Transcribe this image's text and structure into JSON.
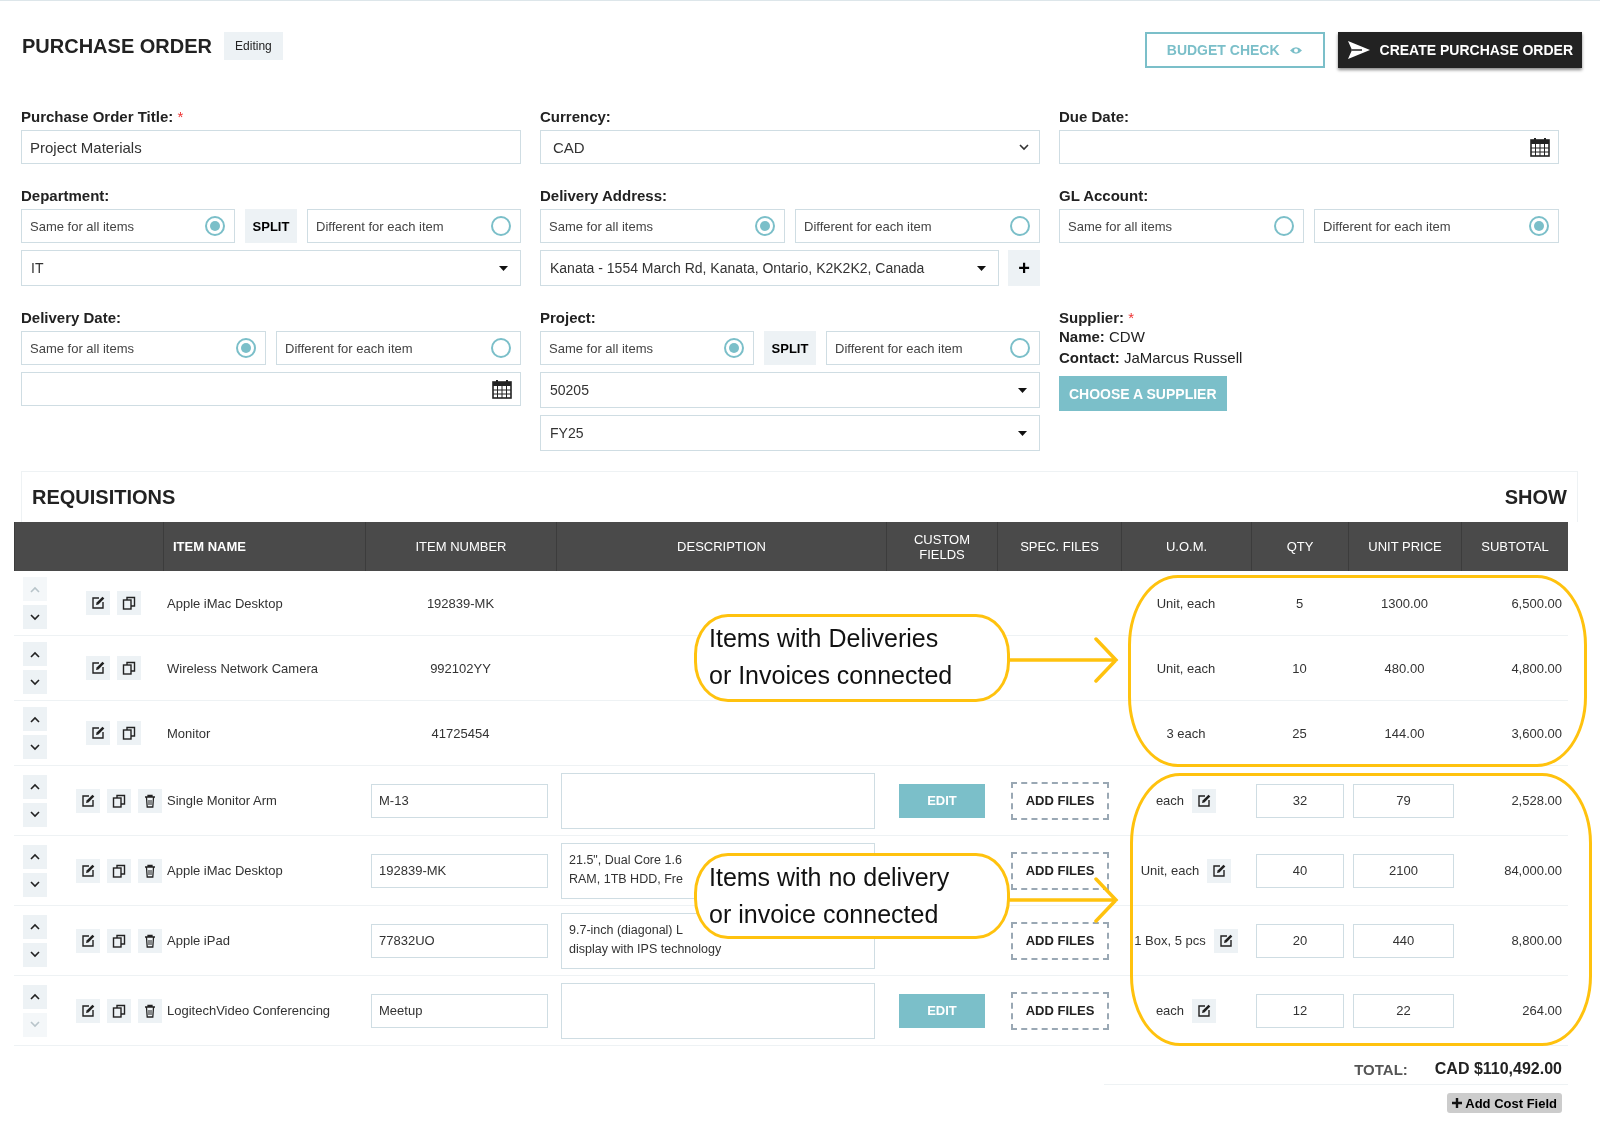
{
  "header": {
    "title": "PURCHASE ORDER",
    "badge": "Editing",
    "buttons": [
      {
        "label": "BUDGET CHECK",
        "kind": "outline"
      },
      {
        "label": "CREATE PURCHASE ORDER",
        "kind": "primary"
      }
    ]
  },
  "form": {
    "groups": [
      {
        "kind": "field",
        "label": "Purchase Order Title:",
        "required_mark": "*",
        "controls": [
          {
            "kind": "text",
            "value": "Project Materials"
          }
        ]
      },
      {
        "kind": "field",
        "label": "Currency:",
        "controls": [
          {
            "kind": "native_select",
            "value": "CAD"
          }
        ]
      },
      {
        "kind": "field",
        "label": "Due Date:",
        "controls": [
          {
            "kind": "date"
          }
        ]
      },
      {
        "kind": "field",
        "label": "Department:",
        "choice": {
          "split": "SPLIT",
          "options": [
            {
              "label": "Same for all items",
              "selected": true
            },
            {
              "label": "Different for each item",
              "selected": false
            }
          ]
        },
        "controls": [
          {
            "kind": "dropdown",
            "value": "IT"
          }
        ]
      },
      {
        "kind": "field",
        "label": "Delivery Address:",
        "choice": {
          "options": [
            {
              "label": "Same for all items",
              "selected": true
            },
            {
              "label": "Different for each item",
              "selected": false
            }
          ]
        },
        "controls": [
          {
            "kind": "dropdown",
            "value": "Kanata - 1554 March Rd, Kanata, Ontario, K2K2K2, Canada",
            "add": "+"
          }
        ]
      },
      {
        "kind": "field",
        "label": "GL Account:",
        "choice": {
          "options": [
            {
              "label": "Same for all items",
              "selected": false
            },
            {
              "label": "Different for each item",
              "selected": true
            }
          ]
        }
      },
      {
        "kind": "field",
        "label": "Delivery Date:",
        "choice": {
          "options": [
            {
              "label": "Same for all items",
              "selected": true
            },
            {
              "label": "Different for each item",
              "selected": false
            }
          ]
        },
        "controls": [
          {
            "kind": "date"
          }
        ]
      },
      {
        "kind": "field",
        "label": "Project:",
        "choice": {
          "split": "SPLIT",
          "options": [
            {
              "label": "Same for all items",
              "selected": true
            },
            {
              "label": "Different for each item",
              "selected": false
            }
          ]
        },
        "controls": [
          {
            "kind": "dropdown",
            "value": "50205"
          },
          {
            "kind": "dropdown",
            "value": "FY25"
          }
        ]
      },
      {
        "kind": "supplier",
        "label": "Supplier:",
        "required_mark": "*",
        "lines": [
          {
            "label": "Name:",
            "value": "CDW"
          },
          {
            "label": "Contact:",
            "value": "JaMarcus Russell"
          }
        ],
        "button": "CHOOSE A SUPPLIER"
      }
    ]
  },
  "requisitions": {
    "title": "REQUISITIONS",
    "toggle": "SHOW",
    "columns": [
      "ITEM NAME",
      "ITEM NUMBER",
      "DESCRIPTION",
      "CUSTOM FIELDS",
      "SPEC. FILES",
      "U.O.M.",
      "QTY",
      "UNIT PRICE",
      "SUBTOTAL"
    ],
    "rows": [
      {
        "kind": "locked",
        "can_move_up": false,
        "can_move_down": true,
        "name": "Apple iMac Desktop",
        "item_number": "192839-MK",
        "uom": "Unit, each",
        "qty": "5",
        "unit_price": "1300.00",
        "subtotal": "6,500.00"
      },
      {
        "kind": "locked",
        "can_move_up": true,
        "can_move_down": true,
        "name": "Wireless Network Camera",
        "item_number": "992102YY",
        "uom": "Unit, each",
        "qty": "10",
        "unit_price": "480.00",
        "subtotal": "4,800.00"
      },
      {
        "kind": "locked",
        "can_move_up": true,
        "can_move_down": true,
        "name": "Monitor",
        "item_number": "41725454",
        "uom": "3 each",
        "qty": "25",
        "unit_price": "144.00",
        "subtotal": "3,600.00"
      },
      {
        "kind": "editable",
        "can_move_up": true,
        "can_move_down": true,
        "name": "Single Monitor Arm",
        "item_number": "M-13",
        "custom_fields": "EDIT",
        "files": "ADD FILES",
        "uom": "each",
        "qty": "32",
        "unit_price": "79",
        "subtotal": "2,528.00"
      },
      {
        "kind": "editable",
        "can_move_up": true,
        "can_move_down": true,
        "name": "Apple iMac Desktop",
        "item_number": "192839-MK",
        "description": "21.5\", Dual Core 1.6\nRAM, 1TB HDD, Fre",
        "files": "ADD FILES",
        "uom": "Unit, each",
        "qty": "40",
        "unit_price": "2100",
        "subtotal": "84,000.00"
      },
      {
        "kind": "editable",
        "can_move_up": true,
        "can_move_down": true,
        "name": "Apple iPad",
        "item_number": "77832UO",
        "description": "9.7-inch (diagonal) L\ndisplay with IPS technology",
        "files": "ADD FILES",
        "uom": "1 Box, 5 pcs",
        "qty": "20",
        "unit_price": "440",
        "subtotal": "8,800.00"
      },
      {
        "kind": "editable",
        "can_move_up": true,
        "can_move_down": false,
        "name": "LogitechVideo Conferencing",
        "item_number": "Meetup",
        "custom_fields": "EDIT",
        "files": "ADD FILES",
        "uom": "each",
        "qty": "12",
        "unit_price": "22",
        "subtotal": "264.00"
      }
    ],
    "total_label": "TOTAL:",
    "total": "CAD $110,492.00",
    "add_cost_field": "Add Cost Field"
  },
  "annotations": [
    {
      "kind": "callout",
      "text": "Items with Deliveries\nor Invoices connected"
    },
    {
      "kind": "callout",
      "text": "Items with no delivery\nor invoice connected"
    }
  ]
}
